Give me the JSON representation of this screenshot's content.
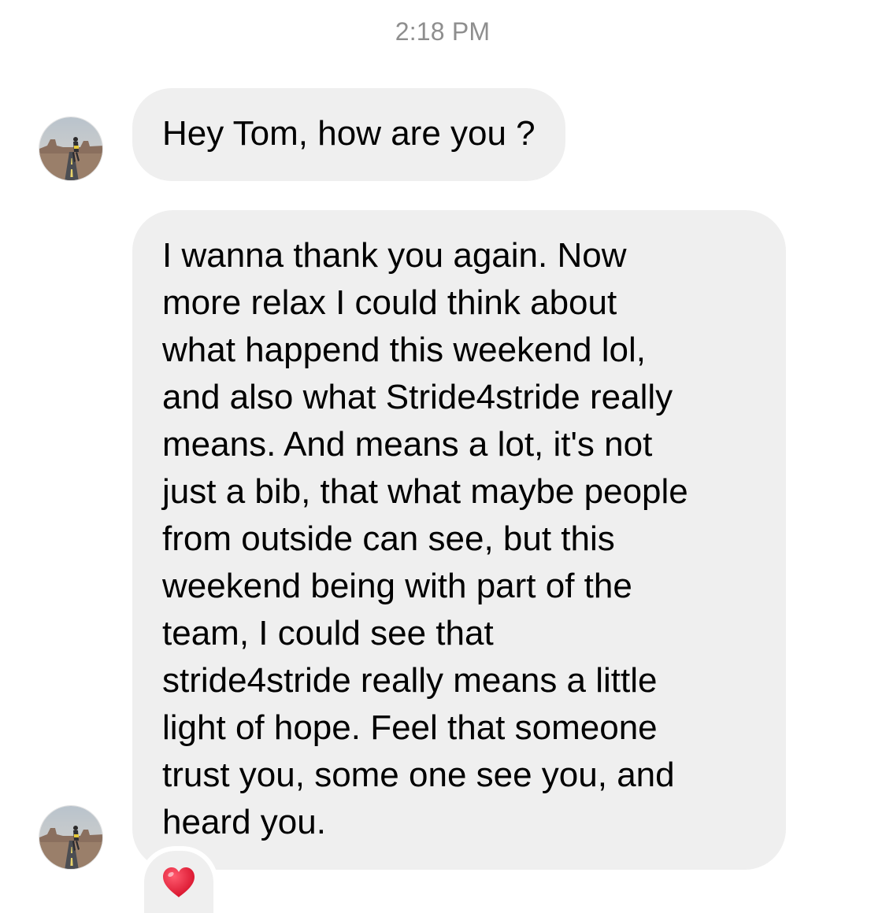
{
  "timestamp": "2:18 PM",
  "messages": [
    {
      "text": "Hey Tom, how are you ?"
    },
    {
      "lines": [
        "I wanna thank you again. Now",
        "more relax I could think about",
        "what happend this weekend lol,",
        "and also what Stride4stride really",
        "means. And means a lot, it's not",
        "just a bib, that what maybe people",
        "from outside can see, but this",
        "weekend being with part of the",
        "team, I could see that",
        "stride4stride really means a little",
        "light of hope. Feel that someone",
        "trust you, some one see you, and",
        "heard you."
      ],
      "reaction": "heart-icon"
    }
  ],
  "colors": {
    "bubble_background": "#efefef",
    "timestamp_text": "#8e8e8e",
    "heart": "#e0102a"
  }
}
